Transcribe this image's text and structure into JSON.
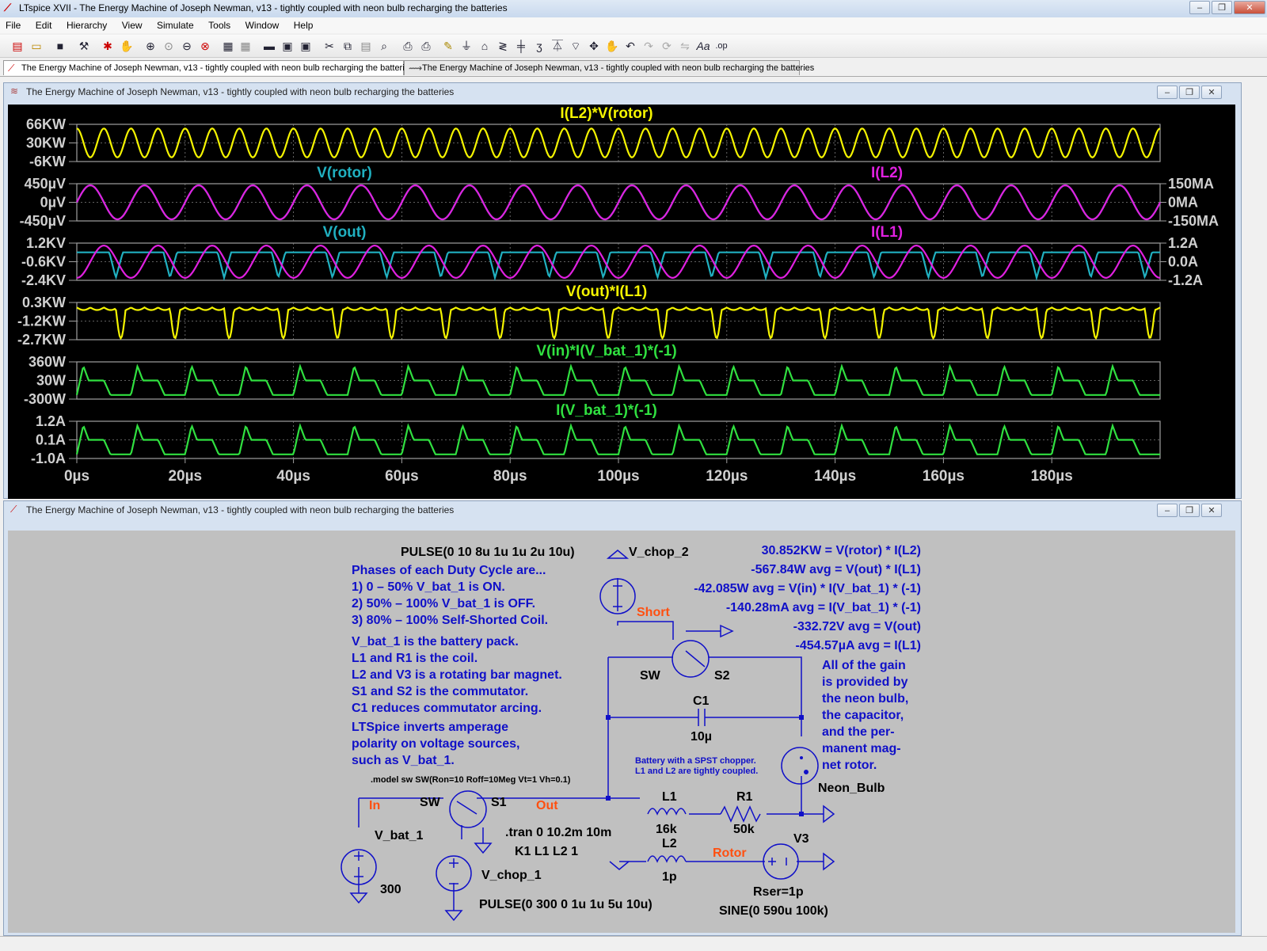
{
  "app": {
    "title": "LTspice XVII - The Energy Machine of Joseph Newman, v13 - tightly coupled with neon bulb recharging the batteries"
  },
  "menu": [
    "File",
    "Edit",
    "Hierarchy",
    "View",
    "Simulate",
    "Tools",
    "Window",
    "Help"
  ],
  "tabs": [
    {
      "label": "The Energy Machine of Joseph Newman, v13 - tightly coupled with neon bulb recharging the batteries",
      "icon": "schematic-icon"
    },
    {
      "label": "The Energy Machine of Joseph Newman, v13 - tightly coupled with neon bulb recharging the batteries",
      "icon": "waveform-icon"
    }
  ],
  "plot_window": {
    "title": "The Energy Machine of Joseph Newman, v13 - tightly coupled with neon bulb recharging the batteries"
  },
  "schematic_window": {
    "title": "The Energy Machine of Joseph Newman, v13 - tightly coupled with neon bulb recharging the batteries"
  },
  "chart_data": {
    "type": "line",
    "x_ticks": [
      "0µs",
      "20µs",
      "40µs",
      "60µs",
      "80µs",
      "100µs",
      "120µs",
      "140µs",
      "160µs",
      "180µs"
    ],
    "xlim": [
      0,
      200
    ],
    "x_unit": "µs",
    "grid": true,
    "panes": [
      {
        "left_ticks": [
          "66KW",
          "30KW",
          "-6KW"
        ],
        "right_ticks": [],
        "series": [
          {
            "name": "I(L2)*V(rotor)",
            "color": "#f4f400",
            "shape": "sine2x"
          }
        ]
      },
      {
        "left_ticks": [
          "450µV",
          "0µV",
          "-450µV"
        ],
        "right_ticks": [
          "150MA",
          "0MA",
          "-150MA"
        ],
        "series": [
          {
            "name": "V(rotor)",
            "color": "#20b0c0",
            "shape": "sine"
          },
          {
            "name": "I(L2)",
            "color": "#e020e0",
            "shape": "sine"
          }
        ]
      },
      {
        "left_ticks": [
          "1.2KV",
          "-0.6KV",
          "-2.4KV"
        ],
        "right_ticks": [
          "1.2A",
          "0.0A",
          "-1.2A"
        ],
        "series": [
          {
            "name": "V(out)",
            "color": "#20b0c0",
            "shape": "vout"
          },
          {
            "name": "I(L1)",
            "color": "#e020e0",
            "shape": "sinephase"
          }
        ]
      },
      {
        "left_ticks": [
          "0.3KW",
          "-1.2KW",
          "-2.7KW"
        ],
        "right_ticks": [],
        "series": [
          {
            "name": "V(out)*I(L1)",
            "color": "#f4f400",
            "shape": "pwr"
          }
        ]
      },
      {
        "left_ticks": [
          "360W",
          "30W",
          "-300W"
        ],
        "right_ticks": [],
        "series": [
          {
            "name": "V(in)*I(V_bat_1)*(-1)",
            "color": "#30e040",
            "shape": "tri"
          }
        ]
      },
      {
        "left_ticks": [
          "1.2A",
          "0.1A",
          "-1.0A"
        ],
        "right_ticks": [],
        "series": [
          {
            "name": "I(V_bat_1)*(-1)",
            "color": "#30e040",
            "shape": "tri"
          }
        ]
      }
    ]
  },
  "schematic": {
    "pulse2": "PULSE(0 10 8u 1u 1u 2u 10u)",
    "vchop2": "V_chop_2",
    "phases_title": "Phases of each Duty Cycle are...",
    "phases": [
      "1)  0 – 50% V_bat_1 is ON.",
      "2)  50% – 100% V_bat_1 is OFF.",
      "3)  80% – 100% Self-Shorted Coil."
    ],
    "notes": [
      "V_bat_1 is the battery pack.",
      "L1 and R1 is the coil.",
      "L2 and V3 is a rotating bar magnet.",
      "S1 and S2 is the commutator.",
      "C1 reduces commutator arcing.",
      "LTSpice inverts amperage",
      "polarity on voltage sources,",
      "such as V_bat_1."
    ],
    "model": ".model sw SW(Ron=10 Roff=10Meg Vt=1 Vh=0.1)",
    "measures": [
      "30.852KW = V(rotor) * I(L2)",
      "-567.84W avg = V(out) * I(L1)",
      "-42.085W avg = V(in) * I(V_bat_1) * (-1)",
      "-140.28mA avg = I(V_bat_1) * (-1)",
      "-332.72V avg = V(out)",
      "-454.57µA avg = I(L1)"
    ],
    "gain_note": [
      "All of the gain",
      "is provided by",
      "the neon bulb,",
      "the capacitor,",
      "and the per-",
      "manent mag-",
      "net rotor."
    ],
    "battery_note": [
      "Battery with a SPST chopper.",
      "L1 and L2 are tightly coupled."
    ],
    "short": "Short",
    "sw2": "SW",
    "s2": "S2",
    "c1": "C1",
    "c1_val": "10µ",
    "neon": "Neon_Bulb",
    "in": "In",
    "sw1": "SW",
    "s1": "S1",
    "out": "Out",
    "l1": "L1",
    "l1_val": "16k",
    "r1": "R1",
    "r1_val": "50k",
    "vbat": "V_bat_1",
    "vbat_val": "300",
    "tran": ".tran 0 10.2m 10m",
    "k1": "K1 L1 L2 1",
    "l2": "L2",
    "l2_val": "1p",
    "rotor": "Rotor",
    "v3": "V3",
    "rser": "Rser=1p",
    "sine": "SINE(0 590u 100k)",
    "vchop1": "V_chop_1",
    "pulse1": "PULSE(0 300 0 1u 1u 5u 10u)"
  }
}
